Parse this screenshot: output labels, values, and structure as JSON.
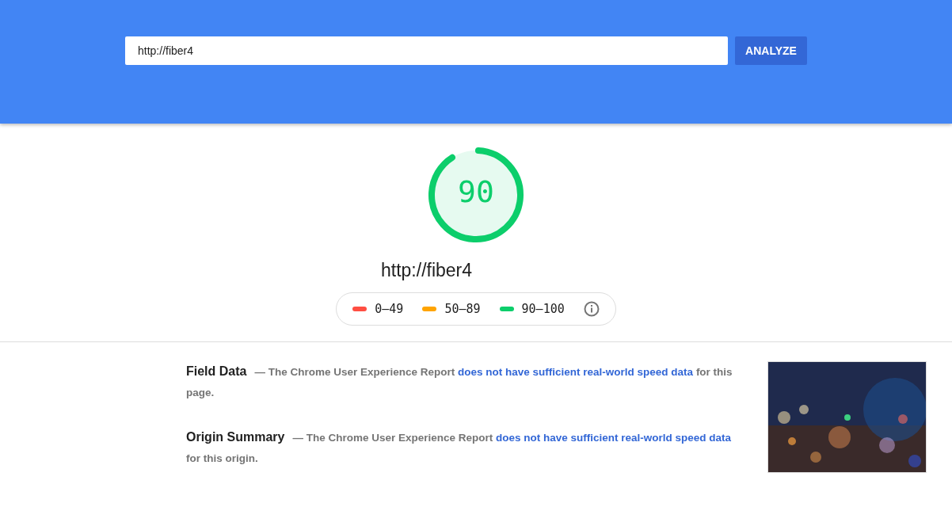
{
  "search": {
    "value": "http://fiber4",
    "button": "ANALYZE"
  },
  "score": {
    "value": "90",
    "level": 0.9,
    "color": "#0cce6b"
  },
  "url": "http://fiber4",
  "legend": [
    {
      "label": "0–49",
      "color": "#ff4e42"
    },
    {
      "label": "50–89",
      "color": "#ffa400"
    },
    {
      "label": "90–100",
      "color": "#0cce6b"
    }
  ],
  "sections": [
    {
      "title": "Field Data",
      "text": "— The Chrome User Experience Report ",
      "link": "does not have sufficient real-world speed data",
      "after": " for this page."
    },
    {
      "title": "Origin Summary",
      "text": "— The Chrome User Experience Report ",
      "link": "does not have sufficient real-world speed data",
      "after": " for this origin."
    }
  ]
}
